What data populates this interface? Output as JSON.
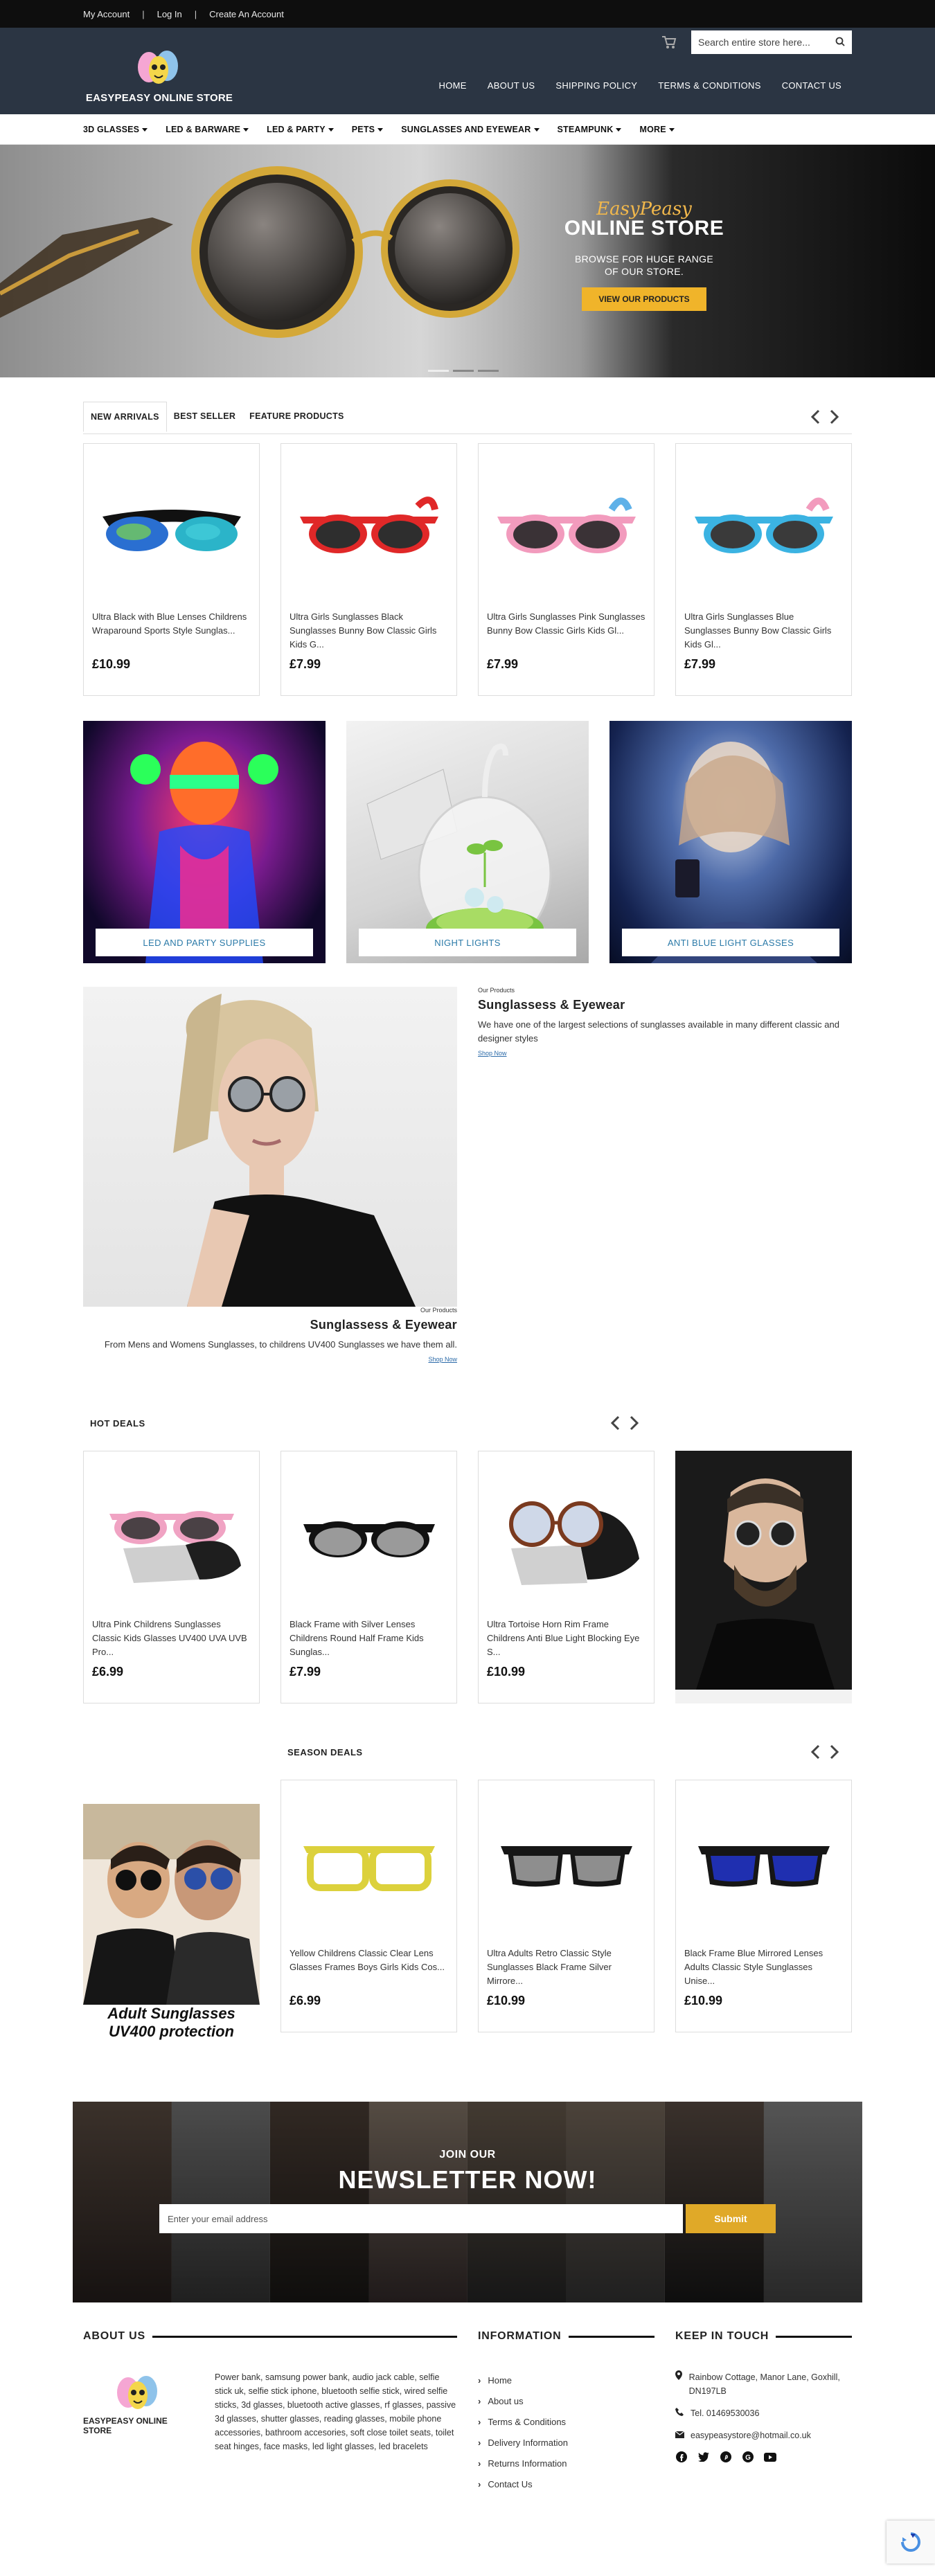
{
  "topbar": {
    "links": [
      "My Account",
      "Log In",
      "Create An Account"
    ],
    "separator": "|"
  },
  "header": {
    "logo_text": "EASYPEASY ONLINE STORE",
    "search_placeholder": "Search entire store here...",
    "nav": [
      "HOME",
      "ABOUT US",
      "SHIPPING POLICY",
      "TERMS & CONDITIONS",
      "CONTACT US"
    ]
  },
  "categories": [
    "3D GLASSES",
    "LED & BARWARE",
    "LED & PARTY",
    "PETS",
    "SUNGLASSES AND EYEWEAR",
    "STEAMPUNK",
    "MORE"
  ],
  "hero": {
    "script": "EasyPeasy",
    "title": "ONLINE STORE",
    "subtitle_1": "BROWSE FOR HUGE RANGE",
    "subtitle_2": "OF OUR STORE.",
    "button": "VIEW OUR PRODUCTS"
  },
  "tabs": [
    "NEW ARRIVALS",
    "BEST SELLER",
    "FEATURE PRODUCTS"
  ],
  "new_arrivals": [
    {
      "title": "Ultra Black with Blue Lenses Childrens Wraparound Sports Style Sunglas...",
      "price": "£10.99"
    },
    {
      "title": "Ultra Girls Sunglasses Black Sunglasses Bunny Bow Classic Girls Kids G...",
      "price": "£7.99"
    },
    {
      "title": "Ultra Girls Sunglasses Pink Sunglasses Bunny Bow Classic Girls Kids Gl...",
      "price": "£7.99"
    },
    {
      "title": "Ultra Girls Sunglasses Blue Sunglasses Bunny Bow Classic Girls Kids Gl...",
      "price": "£7.99"
    }
  ],
  "banners": [
    "LED AND PARTY SUPPLIES",
    "NIGHT LIGHTS",
    "ANTI BLUE LIGHT GLASSES"
  ],
  "feature": {
    "label": "Our Products",
    "title": "Sunglassess & Eyewear",
    "text": "We have one of the largest selections of sunglasses available in many different classic and designer styles",
    "link": "Shop Now",
    "label2": "Our Products",
    "title2": "Sunglassess & Eyewear",
    "text2": "From Mens and Womens Sunglasses, to childrens UV400 Sunglasses we have them all.",
    "link2": "Shop Now"
  },
  "hot_deals": {
    "title": "HOT DEALS",
    "items": [
      {
        "title": "Ultra Pink Childrens Sunglasses Classic Kids Glasses UV400 UVA UVB Pro...",
        "price": "£6.99"
      },
      {
        "title": "Black Frame with Silver Lenses Childrens Round Half Frame Kids Sunglas...",
        "price": "£7.99"
      },
      {
        "title": "Ultra Tortoise Horn Rim Frame Childrens Anti Blue Light Blocking Eye S...",
        "price": "£10.99"
      }
    ]
  },
  "season_deals": {
    "title": "SEASON DEALS",
    "banner_text_1": "Adult Sunglasses",
    "banner_text_2": "UV400 protection",
    "items": [
      {
        "title": "Yellow Childrens Classic Clear Lens Glasses Frames Boys Girls Kids Cos...",
        "price": "£6.99"
      },
      {
        "title": "Ultra Adults Retro Classic Style Sunglasses Black Frame Silver Mirrore...",
        "price": "£10.99"
      },
      {
        "title": "Black Frame Blue Mirrored Lenses Adults Classic Style Sunglasses Unise...",
        "price": "£10.99"
      }
    ]
  },
  "newsletter": {
    "small": "JOIN OUR",
    "big": "NEWSLETTER NOW!",
    "placeholder": "Enter your email address",
    "button": "Submit"
  },
  "footer": {
    "about_title": "ABOUT US",
    "about_logo": "EASYPEASY ONLINE STORE",
    "about_text": "Power bank, samsung power bank, audio jack cable, selfie stick uk, selfie stick iphone, bluetooth selfie stick, wired selfie sticks, 3d glasses, bluetooth active glasses, rf glasses, passive 3d glasses, shutter glasses, reading glasses, mobile phone accessories, bathroom accesories, soft close toilet seats, toilet seat hinges, face masks, led light glasses, led bracelets",
    "info_title": "INFORMATION",
    "info_links": [
      "Home",
      "About us",
      "Terms & Conditions",
      "Delivery Information",
      "Returns Information",
      "Contact Us"
    ],
    "touch_title": "KEEP IN TOUCH",
    "address": "Rainbow Cottage, Manor Lane, Goxhill, DN197LB",
    "phone": "Tel. 01469530036",
    "email": "easypeasystore@hotmail.co.uk"
  },
  "colors": {
    "header_bg": "#2b3543",
    "accent": "#f0b42a",
    "link": "#2b7aa8"
  }
}
